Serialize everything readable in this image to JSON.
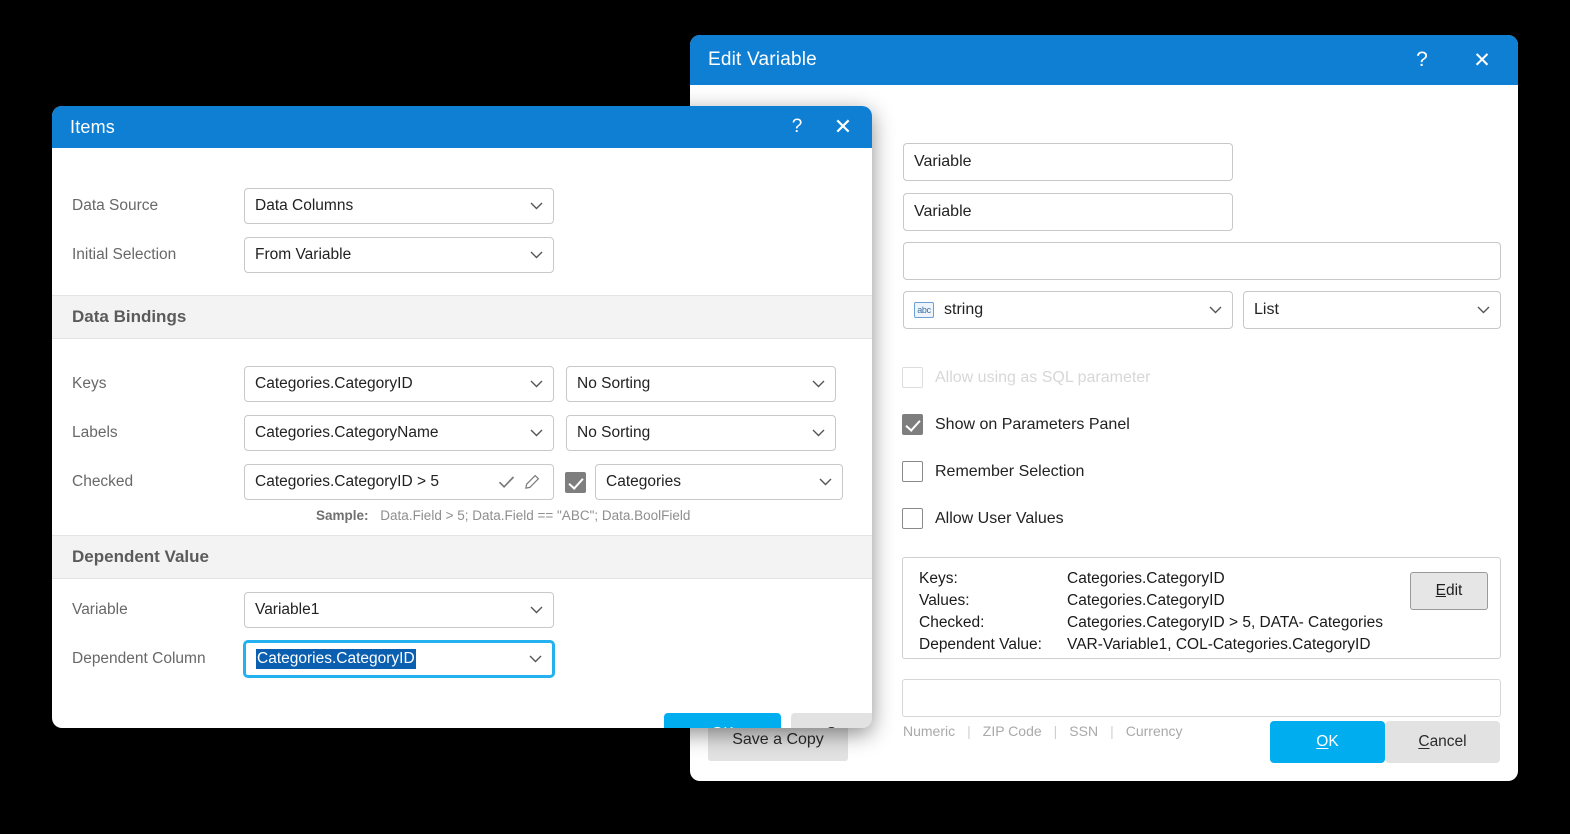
{
  "items_dialog": {
    "title": "Items",
    "help_icon": "?",
    "close_icon": "✕",
    "rows": {
      "data_source": {
        "label": "Data Source",
        "value": "Data Columns"
      },
      "initial_selection": {
        "label": "Initial Selection",
        "value": "From Variable"
      }
    },
    "sections": {
      "data_bindings": "Data Bindings",
      "dependent_value": "Dependent Value"
    },
    "bindings": {
      "keys": {
        "label": "Keys",
        "value": "Categories.CategoryID",
        "sorting": "No Sorting"
      },
      "labels": {
        "label": "Labels",
        "value": "Categories.CategoryName",
        "sorting": "No Sorting"
      },
      "checked": {
        "label": "Checked",
        "value": "Categories.CategoryID > 5",
        "checkbox_checked": true,
        "data_source": "Categories"
      }
    },
    "sample": {
      "label": "Sample:",
      "text": "Data.Field > 5; Data.Field == \"ABC\"; Data.BoolField"
    },
    "dependent": {
      "variable": {
        "label": "Variable",
        "value": "Variable1"
      },
      "column": {
        "label": "Dependent Column",
        "value": "Categories.CategoryID"
      }
    },
    "buttons": {
      "ok": "OK",
      "cancel": "Cancel"
    }
  },
  "edit_variable_dialog": {
    "title": "Edit Variable",
    "help_icon": "?",
    "close_icon": "✕",
    "fields": {
      "name": {
        "value": "Variable"
      },
      "caption": {
        "value": "Variable"
      },
      "description": {
        "value": ""
      }
    },
    "type": {
      "value": "string",
      "icon_label": "abc"
    },
    "kind": {
      "value": "List"
    },
    "checkboxes": [
      {
        "label": "Allow using as SQL parameter",
        "checked": false,
        "disabled": true
      },
      {
        "label": "Show on Parameters Panel",
        "checked": true,
        "disabled": false
      },
      {
        "label": "Remember Selection",
        "checked": false,
        "disabled": false
      },
      {
        "label": "Allow User Values",
        "checked": false,
        "disabled": false
      }
    ],
    "summary": {
      "rows": [
        {
          "name": "Keys:",
          "value": "Categories.CategoryID"
        },
        {
          "name": "Values:",
          "value": "Categories.CategoryID"
        },
        {
          "name": "Checked:",
          "value": "Categories.CategoryID > 5, DATA- Categories"
        },
        {
          "name": "Dependent Value:",
          "value": "VAR-Variable1, COL-Categories.CategoryID"
        }
      ],
      "edit_button": "Edit"
    },
    "mask_field": {
      "value": ""
    },
    "mask_presets": [
      "Numeric",
      "ZIP Code",
      "SSN",
      "Currency"
    ],
    "mask_separator": "|",
    "buttons": {
      "save_a_copy": "Save a Copy",
      "ok": "OK",
      "cancel": "Cancel"
    }
  },
  "colors": {
    "titlebar_blue": "#0f7fd4",
    "primary_button": "#00aef0",
    "focus_outline": "#23b1f0",
    "selection_blue": "#0b5fb0",
    "section_band": "#f3f3f3",
    "checkbox_checked": "#7e7e7e"
  }
}
